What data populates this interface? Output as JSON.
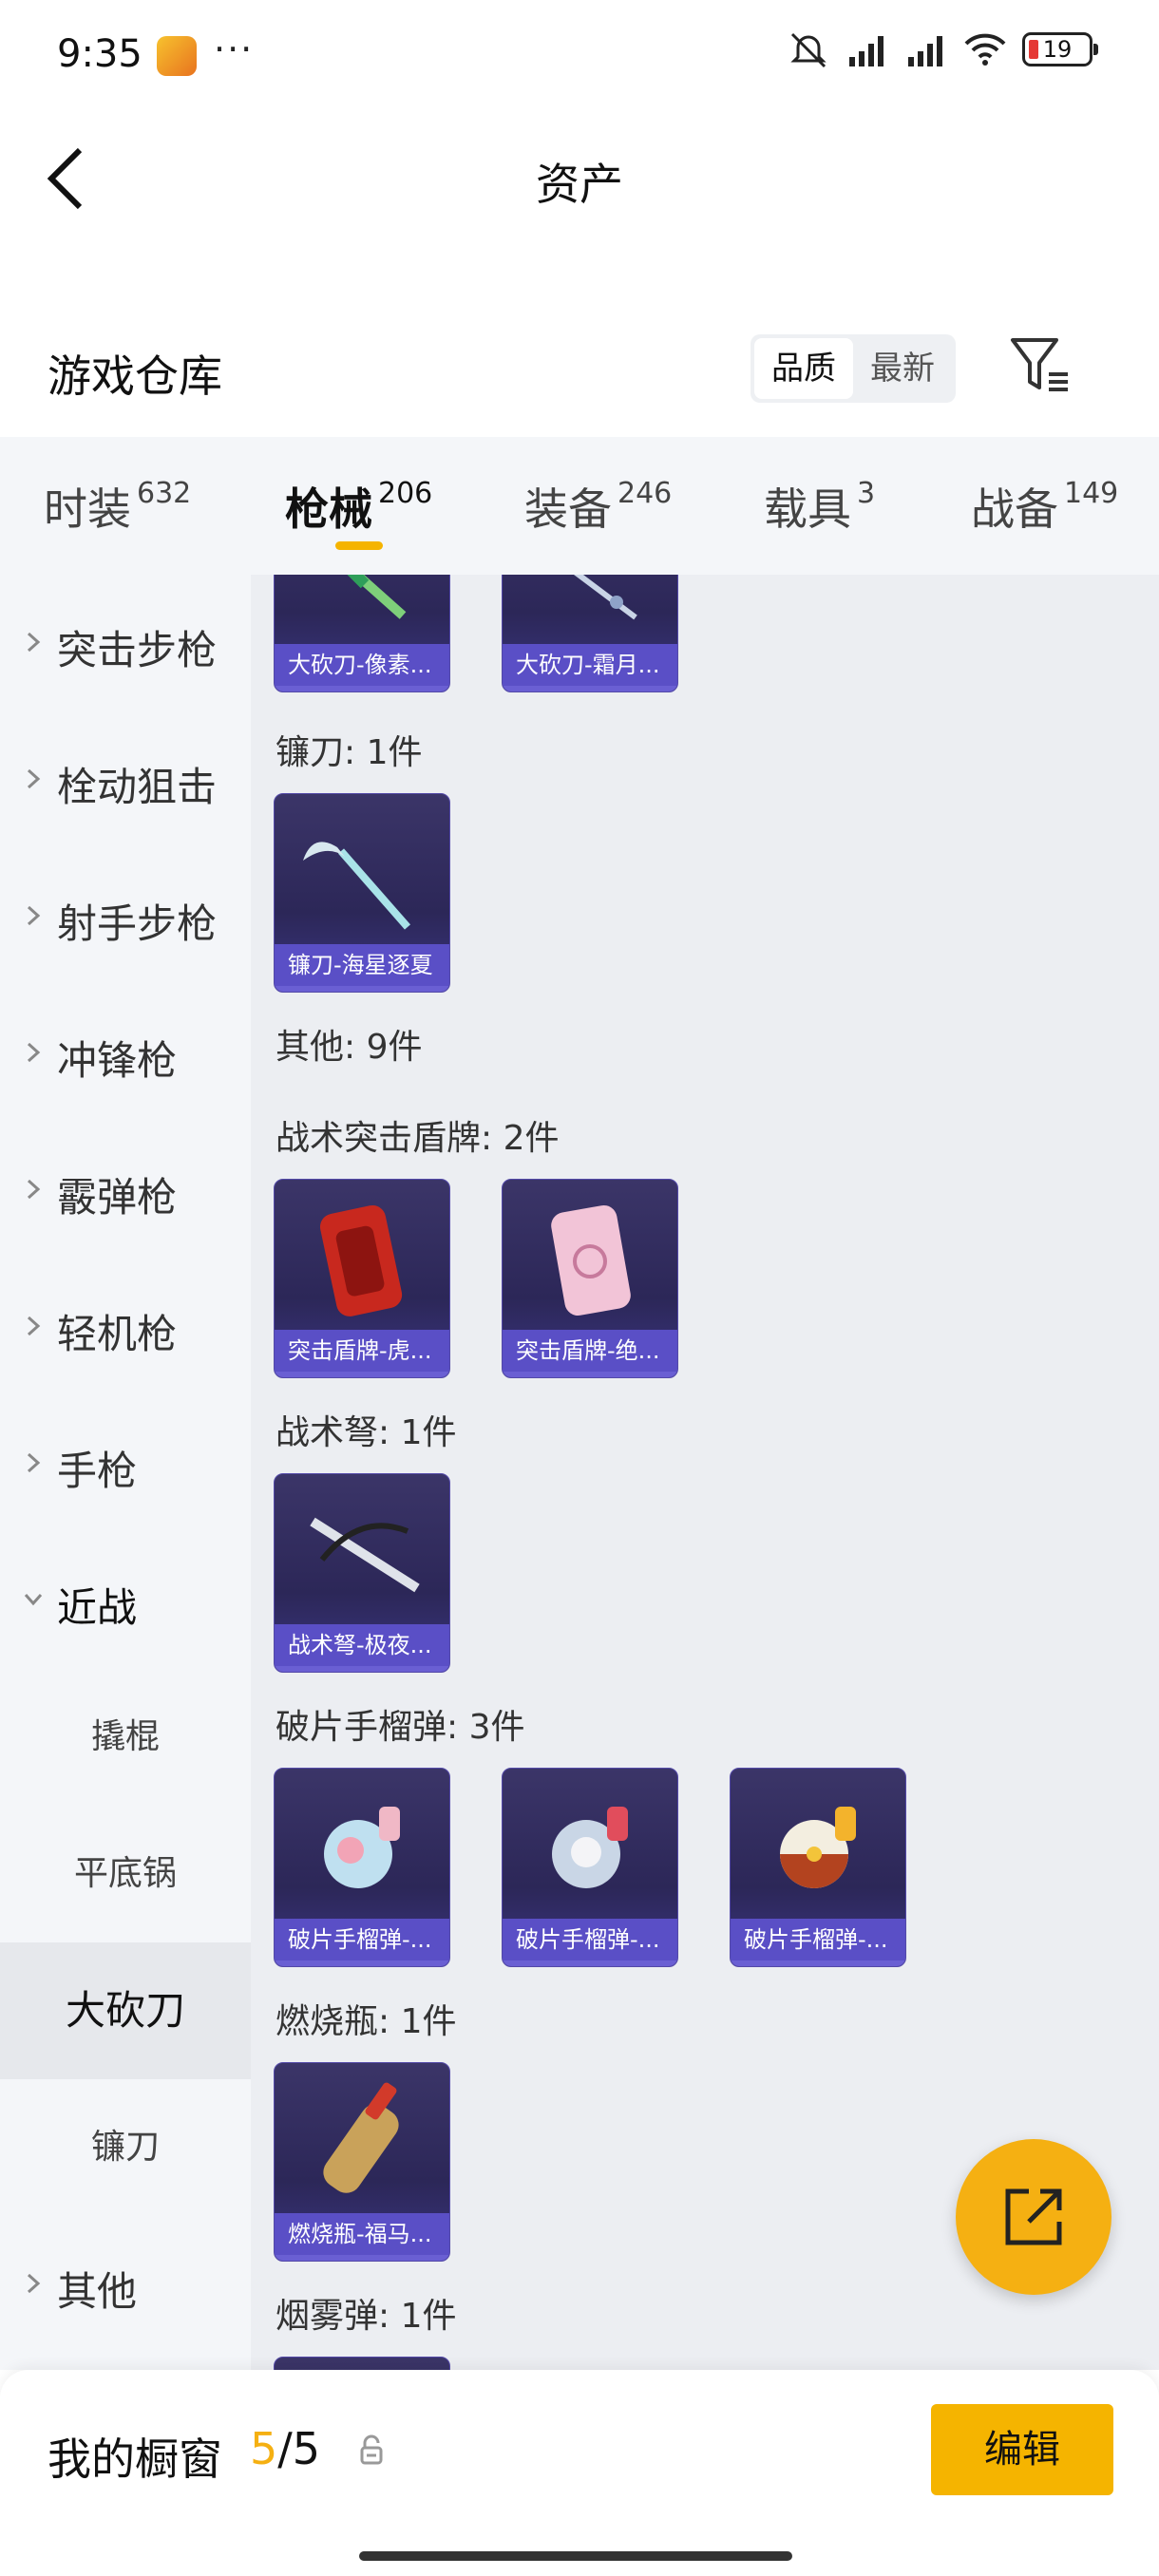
{
  "status": {
    "time": "9:35",
    "dots": "···",
    "battery": "19"
  },
  "header": {
    "title": "资产"
  },
  "section": {
    "title": "游戏仓库",
    "sort_options": [
      "品质",
      "最新"
    ]
  },
  "tabs": [
    {
      "label": "时装",
      "count": "632"
    },
    {
      "label": "枪械",
      "count": "206"
    },
    {
      "label": "装备",
      "count": "246"
    },
    {
      "label": "载具",
      "count": "3"
    },
    {
      "label": "战备",
      "count": "149"
    }
  ],
  "sidenav": {
    "items": [
      "突击步枪",
      "栓动狙击",
      "射手步枪",
      "冲锋枪",
      "霰弹枪",
      "轻机枪",
      "手枪",
      "近战"
    ],
    "sub": [
      "撬棍",
      "平底锅",
      "大砍刀",
      "镰刀"
    ],
    "other": "其他"
  },
  "content": {
    "top_cards": [
      "大砍刀-像素...",
      "大砍刀-霜月..."
    ],
    "groups": [
      {
        "label": "镰刀: 1件",
        "cards": [
          "镰刀-海星逐夏"
        ]
      },
      {
        "label": "其他: 9件"
      },
      {
        "label": "战术突击盾牌: 2件",
        "cards": [
          "突击盾牌-虎...",
          "突击盾牌-绝..."
        ]
      },
      {
        "label": "战术弩: 1件",
        "cards": [
          "战术弩-极夜..."
        ]
      },
      {
        "label": "破片手榴弹: 3件",
        "cards": [
          "破片手榴弹-...",
          "破片手榴弹-...",
          "破片手榴弹-..."
        ]
      },
      {
        "label": "燃烧瓶: 1件",
        "cards": [
          "燃烧瓶-福马..."
        ]
      },
      {
        "label": "烟雾弹: 1件"
      }
    ]
  },
  "bottom": {
    "label": "我的橱窗",
    "count_current": "5",
    "count_sep": "/",
    "count_total": "5",
    "edit_label": "编辑"
  },
  "colors": {
    "accent": "#f5b400",
    "card": "#2c2758",
    "caption": "#5a4fc6"
  }
}
